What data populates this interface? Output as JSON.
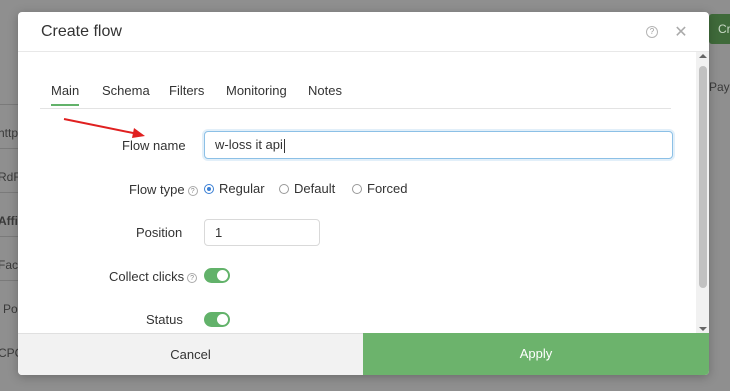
{
  "background": {
    "fragments": [
      "http",
      "RdR",
      "Affi",
      "Fac",
      "Po",
      "CPC"
    ],
    "right_text": "Pay",
    "button_label": "Cr"
  },
  "modal": {
    "title": "Create flow",
    "help_icon": "help-circle-icon",
    "close_icon": "close-icon",
    "tabs": [
      {
        "label": "Main",
        "active": true
      },
      {
        "label": "Schema",
        "active": false
      },
      {
        "label": "Filters",
        "active": false
      },
      {
        "label": "Monitoring",
        "active": false
      },
      {
        "label": "Notes",
        "active": false
      }
    ],
    "form": {
      "flow_name_label": "Flow name",
      "flow_name_value": "w-loss it api",
      "flow_type_label": "Flow type",
      "flow_type_options": [
        {
          "label": "Regular",
          "checked": true
        },
        {
          "label": "Default",
          "checked": false
        },
        {
          "label": "Forced",
          "checked": false
        }
      ],
      "position_label": "Position",
      "position_value": "1",
      "collect_clicks_label": "Collect clicks",
      "collect_clicks_on": true,
      "status_label": "Status",
      "status_on": true
    },
    "footer": {
      "cancel_label": "Cancel",
      "apply_label": "Apply"
    }
  },
  "colors": {
    "accent_green": "#6cb36c",
    "annotation_arrow": "#e02020",
    "focus_blue": "#8cc0e6"
  }
}
